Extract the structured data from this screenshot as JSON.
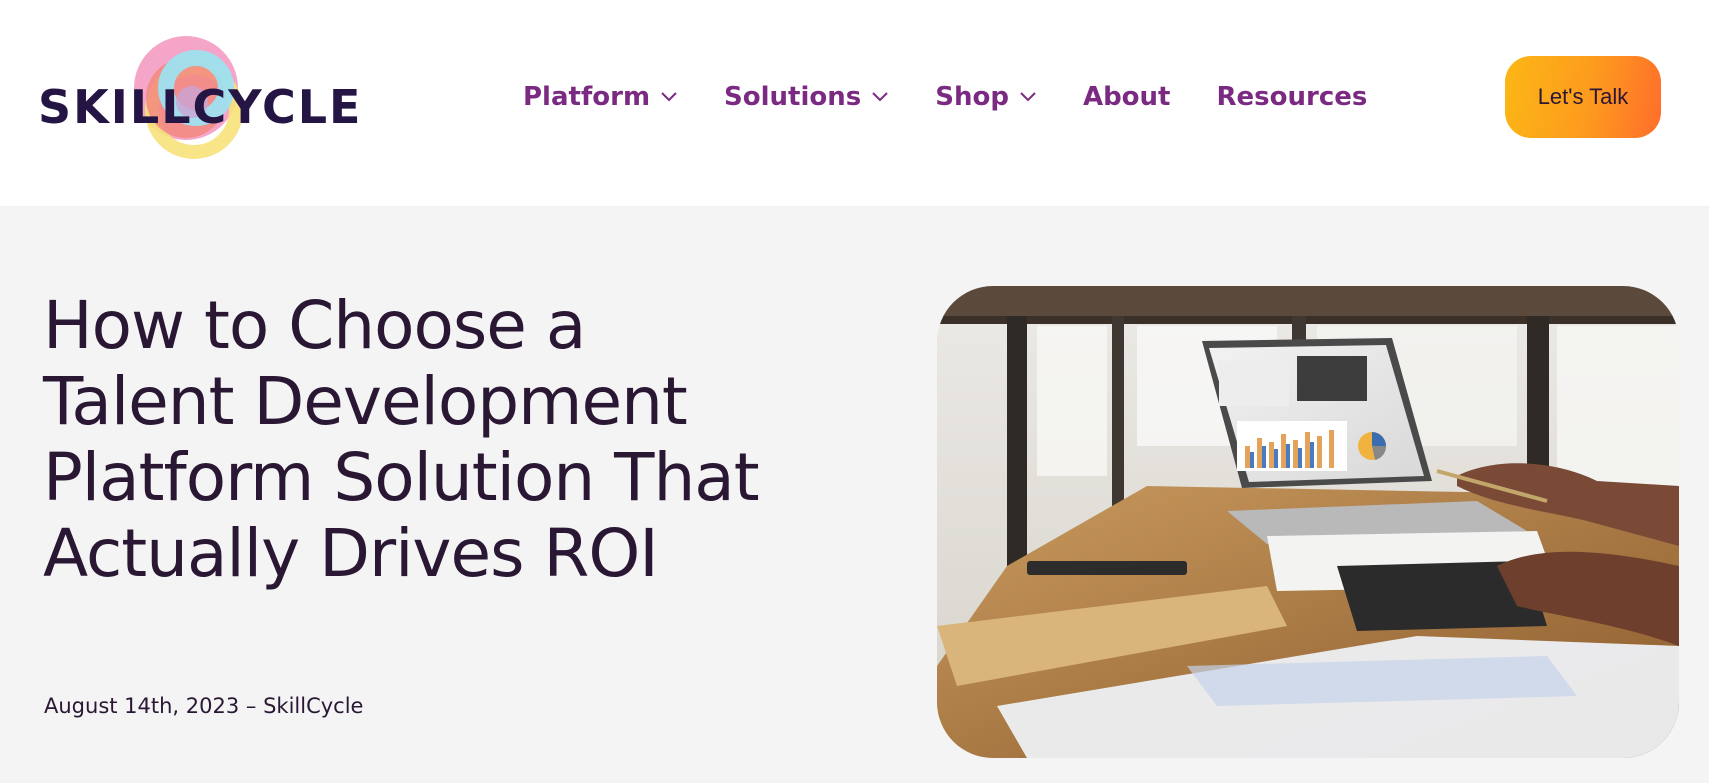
{
  "brand": {
    "name": "SKILLCYCLE",
    "colors": {
      "ring_pink": "#f5a6c8",
      "ring_cyan": "#9ee0ef",
      "ring_yellow": "#f6e27a",
      "ring_coral": "#f2887f"
    }
  },
  "nav": {
    "items": [
      {
        "label": "Platform",
        "has_dropdown": true,
        "icon": "chevron-down-icon"
      },
      {
        "label": "Solutions",
        "has_dropdown": true,
        "icon": "chevron-down-icon"
      },
      {
        "label": "Shop",
        "has_dropdown": true,
        "icon": "chevron-down-icon"
      },
      {
        "label": "About",
        "has_dropdown": false
      },
      {
        "label": "Resources",
        "has_dropdown": false
      }
    ],
    "cta_label": "Let's Talk",
    "accent_color": "#7b2a82",
    "cta_gradient": [
      "#fcb715",
      "#ff6d2b"
    ]
  },
  "article": {
    "title": "How to Choose a Talent Development Platform Solution That Actually Drives ROI",
    "meta": "August 14th, 2023 – SkillCycle"
  }
}
